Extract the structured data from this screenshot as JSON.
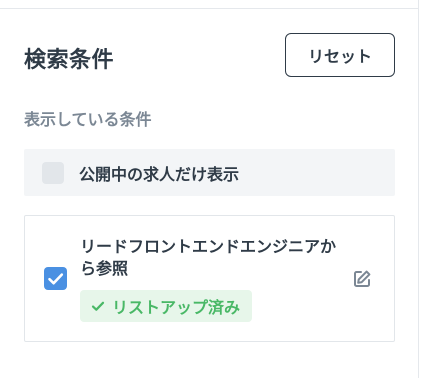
{
  "search_conditions": {
    "title": "検索条件",
    "reset_label": "リセット",
    "displayed_label": "表示している条件",
    "public_only": {
      "label": "公開中の求人だけ表示",
      "checked": false
    },
    "saved_condition": {
      "name": "リードフロントエンドエンジニアから参照",
      "checked": true,
      "status": "リストアップ済み"
    }
  },
  "icons": {
    "checkbox_check": "check-icon",
    "status_check": "check-icon",
    "edit": "edit-icon"
  },
  "colors": {
    "text": "#2f3b47",
    "muted_text": "#7b8794",
    "accent_blue": "#4a90e2",
    "success_green": "#49b866",
    "success_bg": "#e7f6ea",
    "panel_gray": "#f3f5f7"
  }
}
